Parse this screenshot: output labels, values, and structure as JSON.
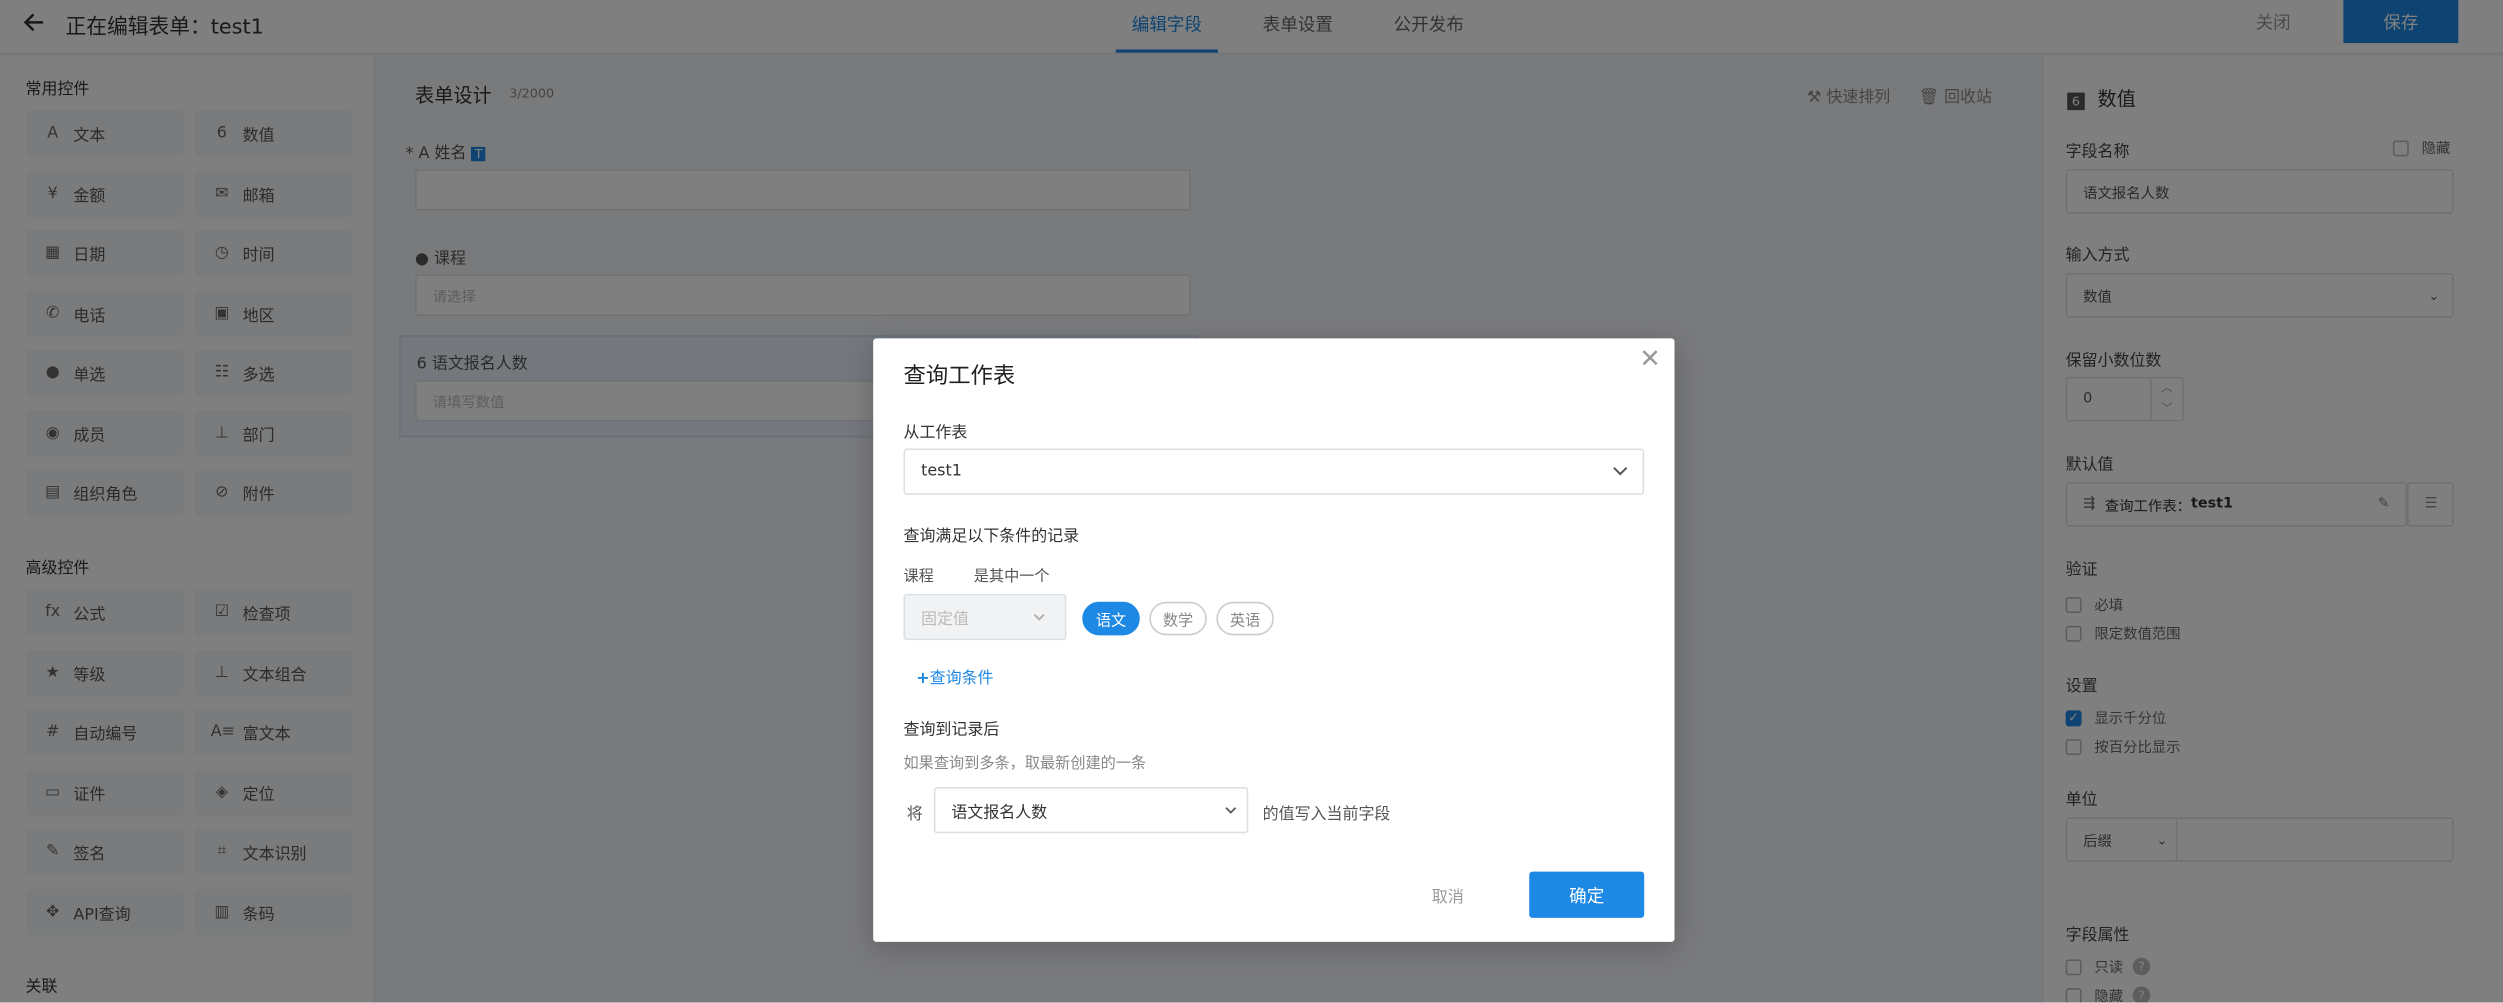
{
  "header": {
    "title_prefix": "正在编辑表单：",
    "title_name": "test1",
    "tabs": [
      "编辑字段",
      "表单设置",
      "公开发布"
    ],
    "close_label": "关闭",
    "save_label": "保存"
  },
  "sidebar": {
    "common_title": "常用控件",
    "common": [
      {
        "icon": "A",
        "label": "文本"
      },
      {
        "icon": "6",
        "label": "数值"
      },
      {
        "icon": "¥",
        "label": "金额"
      },
      {
        "icon": "✉",
        "label": "邮箱"
      },
      {
        "icon": "▦",
        "label": "日期"
      },
      {
        "icon": "◷",
        "label": "时间"
      },
      {
        "icon": "✆",
        "label": "电话"
      },
      {
        "icon": "▣",
        "label": "地区"
      },
      {
        "icon": "●",
        "label": "单选"
      },
      {
        "icon": "☷",
        "label": "多选"
      },
      {
        "icon": "◉",
        "label": "成员"
      },
      {
        "icon": "⊥",
        "label": "部门"
      },
      {
        "icon": "▤",
        "label": "组织角色"
      },
      {
        "icon": "⊘",
        "label": "附件"
      }
    ],
    "advanced_title": "高级控件",
    "advanced": [
      {
        "icon": "fx",
        "label": "公式"
      },
      {
        "icon": "☑",
        "label": "检查项"
      },
      {
        "icon": "★",
        "label": "等级"
      },
      {
        "icon": "⊥",
        "label": "文本组合"
      },
      {
        "icon": "#",
        "label": "自动编号"
      },
      {
        "icon": "A≡",
        "label": "富文本"
      },
      {
        "icon": "▭",
        "label": "证件"
      },
      {
        "icon": "◈",
        "label": "定位"
      },
      {
        "icon": "✎",
        "label": "签名"
      },
      {
        "icon": "⌗",
        "label": "文本识别"
      },
      {
        "icon": "✥",
        "label": "API查询"
      },
      {
        "icon": "▥",
        "label": "条码"
      }
    ],
    "relation_title": "关联"
  },
  "canvas": {
    "title": "表单设计",
    "count": "3/2000",
    "quick_sort": "快速排列",
    "recycle": "回收站",
    "field1_label": "姓名",
    "field2_label": "课程",
    "field2_placeholder": "请选择",
    "field3_label": "语文报名人数",
    "field3_placeholder": "请填写数值"
  },
  "right_panel": {
    "title": "数值",
    "field_name_label": "字段名称",
    "hide_label": "隐藏",
    "field_name_value": "语文报名人数",
    "input_mode_label": "输入方式",
    "input_mode_value": "数值",
    "decimals_label": "保留小数位数",
    "decimals_value": "0",
    "default_label": "默认值",
    "default_prefix": "查询工作表：",
    "default_value": "test1",
    "validate_label": "验证",
    "required_label": "必填",
    "range_label": "限定数值范围",
    "settings_label": "设置",
    "thousands_label": "显示千分位",
    "percent_label": "按百分比显示",
    "unit_label": "单位",
    "unit_value": "后缀",
    "field_attr_label": "字段属性",
    "readonly_label": "只读",
    "hidden_label": "隐藏"
  },
  "modal": {
    "title": "查询工作表",
    "from_label": "从工作表",
    "from_value": "test1",
    "cond_title": "查询满足以下条件的记录",
    "cond_field": "课程",
    "cond_op": "是其中一个",
    "cond_value_type": "固定值",
    "tags": [
      "语文",
      "数学",
      "英语"
    ],
    "active_tag": "语文",
    "add_cond": "查询条件",
    "after_title": "查询到记录后",
    "after_hint": "如果查询到多条，取最新创建的一条",
    "write_prefix": "将",
    "write_field": "语文报名人数",
    "write_suffix": "的值写入当前字段",
    "cancel_label": "取消",
    "ok_label": "确定"
  },
  "colors": {
    "accent": "#1e88e5",
    "overlay": "#000000"
  }
}
